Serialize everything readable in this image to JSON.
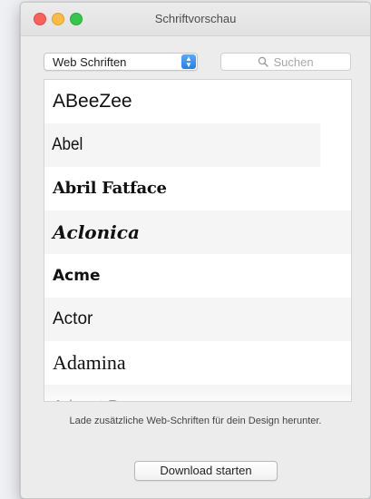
{
  "window": {
    "title": "Schriftvorschau"
  },
  "toolbar": {
    "category_select": {
      "value": "Web Schriften"
    },
    "search": {
      "placeholder": "Suchen"
    }
  },
  "font_list": {
    "items": [
      {
        "label": "ABeeZee"
      },
      {
        "label": "Abel"
      },
      {
        "label": "Abril Fatface"
      },
      {
        "label": "Aclonica"
      },
      {
        "label": "Acme"
      },
      {
        "label": "Actor"
      },
      {
        "label": "Adamina"
      },
      {
        "label": "Advent Pro"
      }
    ]
  },
  "footer": {
    "info_text": "Lade zusätzliche Web-Schriften für dein Design herunter.",
    "download_label": "Download starten"
  },
  "colors": {
    "accent": "#1f7ff0",
    "close": "#fc605c",
    "minimize": "#fdbc40",
    "maximize": "#34c84a"
  },
  "icons": {
    "search": "search-icon",
    "select_arrows": "chevron-up-down-icon"
  }
}
